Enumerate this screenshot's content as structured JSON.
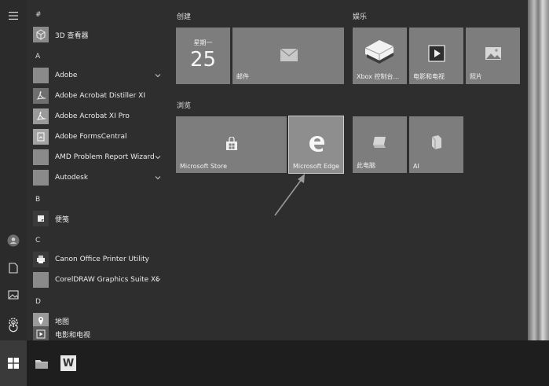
{
  "rail": {
    "icons": [
      "hamburger-icon",
      "user-icon",
      "document-icon",
      "pictures-icon",
      "settings-icon",
      "power-icon"
    ]
  },
  "applist": {
    "letters": {
      "hash": "#",
      "a": "A",
      "b": "B",
      "c": "C",
      "d": "D"
    },
    "apps": [
      {
        "label": "3D 查看器",
        "icon": "cube-icon"
      },
      {
        "label": "Adobe",
        "icon": "folder-icon",
        "expandable": true
      },
      {
        "label": "Adobe Acrobat Distiller XI",
        "icon": "acrobat-icon"
      },
      {
        "label": "Adobe Acrobat XI Pro",
        "icon": "acrobat-icon"
      },
      {
        "label": "Adobe FormsCentral",
        "icon": "forms-icon"
      },
      {
        "label": "AMD Problem Report Wizard",
        "icon": "folder-icon",
        "expandable": true
      },
      {
        "label": "Autodesk",
        "icon": "folder-icon",
        "expandable": true
      },
      {
        "label": "便笺",
        "icon": "sticky-notes-icon"
      },
      {
        "label": "Canon Office Printer Utility",
        "icon": "printer-icon"
      },
      {
        "label": "CorelDRAW Graphics Suite X8...",
        "icon": "folder-icon",
        "expandable": true
      },
      {
        "label": "地图",
        "icon": "map-icon"
      },
      {
        "label": "电影和电视",
        "icon": "video-icon"
      }
    ]
  },
  "groups": {
    "create": "创建",
    "play": "娱乐",
    "browse": "浏览"
  },
  "tiles": {
    "calendar": {
      "day": "星期一",
      "date": "25"
    },
    "mail": {
      "label": "邮件"
    },
    "xbox": {
      "label": "Xbox 控制台..."
    },
    "movies": {
      "label": "电影和电视"
    },
    "photos": {
      "label": "照片"
    },
    "store": {
      "label": "Microsoft Store"
    },
    "edge": {
      "label": "Microsoft Edge"
    },
    "pc": {
      "label": "此电脑"
    },
    "ai": {
      "label": "AI"
    }
  },
  "taskbar": {
    "items": [
      "windows-start-icon",
      "file-explorer-icon",
      "word-icon"
    ],
    "word_letter": "W"
  },
  "colors": {
    "tile": "#7d7d7d",
    "background": "#2e2e2e",
    "taskbar": "#1e1e1e"
  }
}
